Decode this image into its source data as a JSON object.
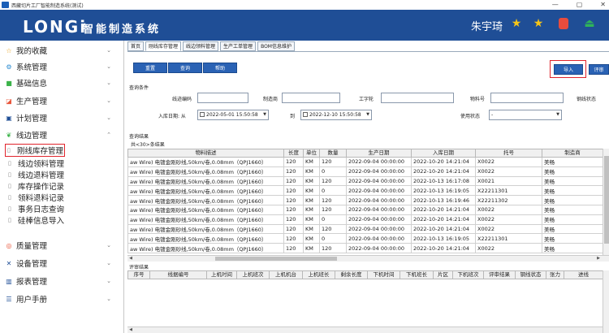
{
  "window": {
    "title": "西藏切片工厂智能制造系统(测试)",
    "controls": [
      "—",
      "▢",
      "✕"
    ]
  },
  "header": {
    "logo": "LONGi",
    "system_title": "智能制造系统",
    "user": "朱宇琦",
    "colors": {
      "bg": "#1f4e96",
      "star": "#f5c518",
      "lock": "#e84c3d",
      "exit": "#2fb35a"
    }
  },
  "sidebar": {
    "items": [
      {
        "label": "我的收藏",
        "icon": "star-icon"
      },
      {
        "label": "系统管理",
        "icon": "gear-icon"
      },
      {
        "label": "基础信息",
        "icon": "square-icon"
      },
      {
        "label": "生产管理",
        "icon": "briefcase-icon"
      },
      {
        "label": "计划管理",
        "icon": "calendar-icon"
      },
      {
        "label": "线边管理",
        "icon": "leaf-icon"
      },
      {
        "label": "质量管理",
        "icon": "target-icon"
      },
      {
        "label": "设备管理",
        "icon": "wrench-icon"
      },
      {
        "label": "报表管理",
        "icon": "bar-chart-icon"
      },
      {
        "label": "用户手册",
        "icon": "stack-icon"
      }
    ],
    "subitems": [
      "刚线库存管理",
      "线边领料管理",
      "线边退料管理",
      "库存操作记录",
      "领料退料记录",
      "事务日志查询",
      "硅棒信息导入"
    ]
  },
  "tabs": [
    "首页",
    "刚线库存管理",
    "线边领料管理",
    "生产工单管理",
    "BOM信息维护"
  ],
  "toolbar": {
    "reset": "重置",
    "query": "查询",
    "help": "帮助",
    "import": "导入",
    "eval": "评审"
  },
  "query": {
    "section_title": "查询条件",
    "line_code_label": "线迹编码",
    "maker_label": "制造商",
    "craft_label": "工字轮",
    "material_label": "物料号",
    "line_status_label": "钢线状态",
    "date_label": "入库日期: 从",
    "date_from": "2022-05-01 15:50:58",
    "to_label": "到",
    "date_to": "2022-12-10 15:50:58",
    "use_status_label": "使用状态",
    "use_status_value": "-"
  },
  "results": {
    "section_title": "查询结果",
    "count_text": "共<30>条结果",
    "columns": [
      "物料描述",
      "长度",
      "单位",
      "数量",
      "生产日期",
      "入库日期",
      "托号",
      "制造商"
    ],
    "rows": [
      [
        "aw Wire)  电镀金刚砂线,50km/卷,0.08mm（QPJ1660）",
        "120",
        "KM",
        "120",
        "2022-09-04 00:00:00",
        "2022-10-20 14:21:04",
        "X0022",
        "美畅"
      ],
      [
        "aw Wire)  电镀金刚砂线,50km/卷,0.08mm（QPJ1660）",
        "120",
        "KM",
        "0",
        "2022-09-04 00:00:00",
        "2022-10-20 14:21:04",
        "X0022",
        "美畅"
      ],
      [
        "aw Wire)  电镀金刚砂线,50km/卷,0.08mm（QPJ1660）",
        "120",
        "KM",
        "120",
        "2022-09-04 00:00:00",
        "2022-10-13 16:17:08",
        "X0021",
        "美畅"
      ],
      [
        "aw Wire)  电镀金刚砂线,50km/卷,0.08mm（QPJ1660）",
        "120",
        "KM",
        "0",
        "2022-09-04 00:00:00",
        "2022-10-13 16:19:05",
        "X22211301",
        "美畅"
      ],
      [
        "aw Wire)  电镀金刚砂线,50km/卷,0.08mm（QPJ1660）",
        "120",
        "KM",
        "120",
        "2022-09-04 00:00:00",
        "2022-10-13 16:19:46",
        "X22211302",
        "美畅"
      ],
      [
        "aw Wire)  电镀金刚砂线,50km/卷,0.08mm（QPJ1660）",
        "120",
        "KM",
        "120",
        "2022-09-04 00:00:00",
        "2022-10-20 14:21:04",
        "X0022",
        "美畅"
      ],
      [
        "aw Wire)  电镀金刚砂线,50km/卷,0.08mm（QPJ1660）",
        "120",
        "KM",
        "0",
        "2022-09-04 00:00:00",
        "2022-10-20 14:21:04",
        "X0022",
        "美畅"
      ],
      [
        "aw Wire)  电镀金刚砂线,50km/卷,0.08mm（QPJ1660）",
        "120",
        "KM",
        "120",
        "2022-09-04 00:00:00",
        "2022-10-20 14:21:04",
        "X0022",
        "美畅"
      ],
      [
        "aw Wire)  电镀金刚砂线,50km/卷,0.08mm（QPJ1660）",
        "120",
        "KM",
        "0",
        "2022-09-04 00:00:00",
        "2022-10-13 16:19:05",
        "X22211301",
        "美畅"
      ],
      [
        "aw Wire)  电镀金刚砂线,50km/卷,0.08mm（QPJ1660）",
        "120",
        "KM",
        "120",
        "2022-09-04 00:00:00",
        "2022-10-20 14:21:04",
        "X0022",
        "美畅"
      ]
    ]
  },
  "review": {
    "section_title": "评审结果",
    "columns": [
      "序号",
      "线据编号",
      "上机时间",
      "上机班次",
      "上机机台",
      "上机班长",
      "剩余长度",
      "下机时间",
      "下机班长",
      "片区",
      "下机班次",
      "评审结果",
      "钢线状态",
      "张力",
      "进线"
    ]
  }
}
